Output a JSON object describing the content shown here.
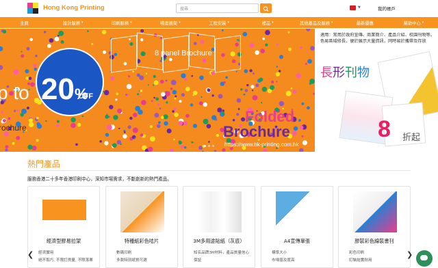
{
  "header": {
    "brand": "Hong Kong Printing",
    "search_placeholder": "搜尋",
    "account": "我的帳戶"
  },
  "nav": [
    {
      "label": "主頁",
      "caret": false
    },
    {
      "label": "設計服務",
      "caret": true
    },
    {
      "label": "印刷服務",
      "caret": true
    },
    {
      "label": "噴畫展架",
      "caret": true
    },
    {
      "label": "工程安裝",
      "caret": true
    },
    {
      "label": "禮品",
      "caret": true
    },
    {
      "label": "其他產品及服務",
      "caret": true
    },
    {
      "label": "最新優惠",
      "caret": false
    },
    {
      "label": "幫助中心",
      "caret": true
    }
  ],
  "banner": {
    "up_to": "p to",
    "percent": "20",
    "percent_sign": "%",
    "off": "OFF",
    "brochure_left": "rochure",
    "panel_label": "8 panel Brochure",
    "folded": "Folded",
    "brochure": "Brochure",
    "url": "https://www.hk-printing.com.hk"
  },
  "promo": {
    "text": "適用：常用於政府宣傳、商業簡介、產品介紹、校園刊物等。色易區域修長，便於展示大量資訊，同時易於攜帶及存放",
    "title_1": "長",
    "title_2": "形",
    "title_3": "刊",
    "title_4": "物",
    "number": "8",
    "suffix": "折起"
  },
  "hot": {
    "title": "熱門產品",
    "subtitle": "服務香港二十多年香港印刷中心，深知市場需求，不斷創新的熱門產品。"
  },
  "products": [
    {
      "name": "經濟型膠易拉架",
      "d1": "經濟實用",
      "d2": "絕不取巧, 不限訂貨量, 不限落單"
    },
    {
      "name": "特種紙彩色咭片",
      "d1": "數碼印刷",
      "d2": "多款特別紙質可選"
    },
    {
      "name": "3M多用途貼紙（灰底）",
      "d1": "知名品牌3M材料，產品質量信心",
      "d2": "保証"
    },
    {
      "name": "A4宣傳單張",
      "d1": "標準大小",
      "d2": "市場普及度高"
    },
    {
      "name": "膠裝彩色線裝書刊",
      "d1": "彩色印刷",
      "d2": "釘裝結實耐用"
    }
  ],
  "colors": {
    "accent": "#f7931e",
    "badge": "#1a56c4",
    "pink": "#e83e8c",
    "purple": "#6a2a9c"
  }
}
